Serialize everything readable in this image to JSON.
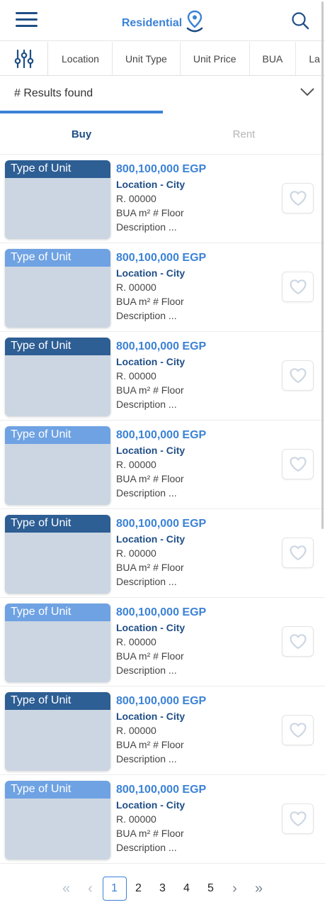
{
  "header": {
    "title": "Residential",
    "menu_icon": "hamburger-menu-icon",
    "title_icon": "location-pin-icon",
    "search_icon": "search-icon"
  },
  "filters": {
    "icon": "sliders-icon",
    "chips": [
      "Location",
      "Unit Type",
      "Unit Price",
      "BUA",
      "La"
    ]
  },
  "results": {
    "label": "# Results found",
    "icon": "chevron-down-icon"
  },
  "tabs": {
    "items": [
      {
        "label": "Buy",
        "active": true
      },
      {
        "label": "Rent",
        "active": false
      }
    ]
  },
  "listings": [
    {
      "type": "Type of Unit",
      "price": "800,100,000 EGP",
      "location": "Location - City",
      "ref": "R. 00000",
      "specs": "BUA m²  # Floor",
      "description": "Description ..."
    },
    {
      "type": "Type of Unit",
      "price": "800,100,000 EGP",
      "location": "Location - City",
      "ref": "R. 00000",
      "specs": "BUA m²  # Floor",
      "description": "Description ..."
    },
    {
      "type": "Type of Unit",
      "price": "800,100,000 EGP",
      "location": "Location - City",
      "ref": "R. 00000",
      "specs": "BUA m²  # Floor",
      "description": "Description ..."
    },
    {
      "type": "Type of Unit",
      "price": "800,100,000 EGP",
      "location": "Location - City",
      "ref": "R. 00000",
      "specs": "BUA m²  # Floor",
      "description": "Description ..."
    },
    {
      "type": "Type of Unit",
      "price": "800,100,000 EGP",
      "location": "Location - City",
      "ref": "R. 00000",
      "specs": "BUA m²  # Floor",
      "description": "Description ..."
    },
    {
      "type": "Type of Unit",
      "price": "800,100,000 EGP",
      "location": "Location - City",
      "ref": "R. 00000",
      "specs": "BUA m²  # Floor",
      "description": "Description ..."
    },
    {
      "type": "Type of Unit",
      "price": "800,100,000 EGP",
      "location": "Location - City",
      "ref": "R. 00000",
      "specs": "BUA m²  # Floor",
      "description": "Description ..."
    },
    {
      "type": "Type of Unit",
      "price": "800,100,000 EGP",
      "location": "Location - City",
      "ref": "R. 00000",
      "specs": "BUA m²  # Floor",
      "description": "Description ..."
    }
  ],
  "favorite_icon": "heart-outline-icon",
  "pagination": {
    "first": "«",
    "prev": "‹",
    "pages": [
      "1",
      "2",
      "3",
      "4",
      "5"
    ],
    "current": "1",
    "next": "›",
    "last": "»"
  },
  "colors": {
    "accent": "#3b82d6",
    "navy": "#1f4e86",
    "label_dark": "#2d5e94",
    "label_light": "#6ea2e3"
  }
}
